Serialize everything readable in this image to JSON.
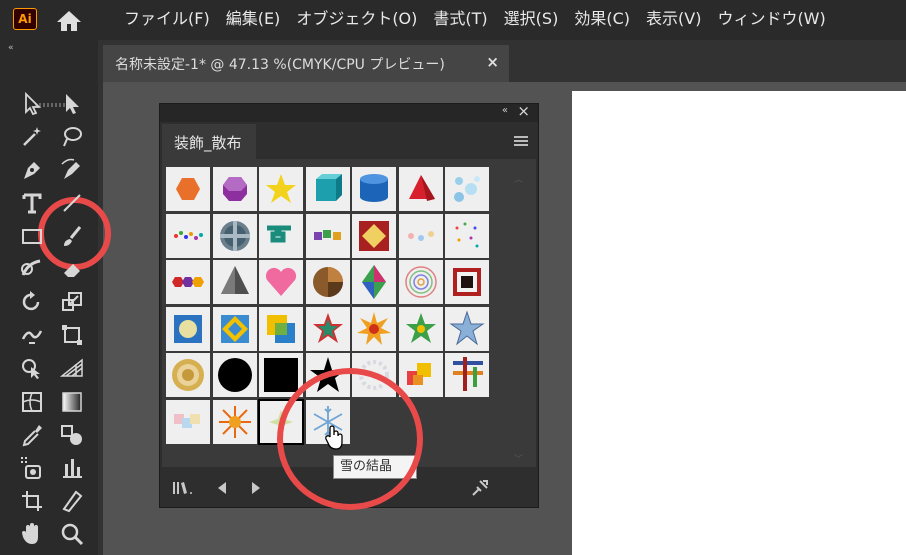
{
  "app": {
    "logo": "Ai"
  },
  "menu": [
    "ファイル(F)",
    "編集(E)",
    "オブジェクト(O)",
    "書式(T)",
    "選択(S)",
    "効果(C)",
    "表示(V)",
    "ウィンドウ(W)"
  ],
  "toolbar": {
    "collapse": "«",
    "tools": [
      "selection",
      "direct-selection",
      "magic-wand",
      "lasso",
      "pen",
      "curvature",
      "type",
      "line",
      "rectangle",
      "paintbrush",
      "shaper",
      "eraser",
      "rotate",
      "scale",
      "width",
      "free-transform",
      "shape-builder",
      "perspective-grid",
      "mesh",
      "gradient",
      "eyedropper",
      "blend",
      "symbol-sprayer",
      "column-graph",
      "artboard",
      "slice",
      "hand",
      "zoom"
    ]
  },
  "document": {
    "tab_title": "名称未設定-1* @ 47.13 %(CMYK/CPU プレビュー)",
    "close": "×"
  },
  "panel": {
    "collapse": "«",
    "close": "×",
    "tab_label": "装飾_散布",
    "symbols_count": 38,
    "selected_index": 38,
    "tooltip": "雪の結晶"
  },
  "colors": {
    "accent": "#e84a4a",
    "app_bg": "#2a2a2a",
    "panel_bg": "#3a3a3a",
    "logo": "#ff9a00"
  }
}
